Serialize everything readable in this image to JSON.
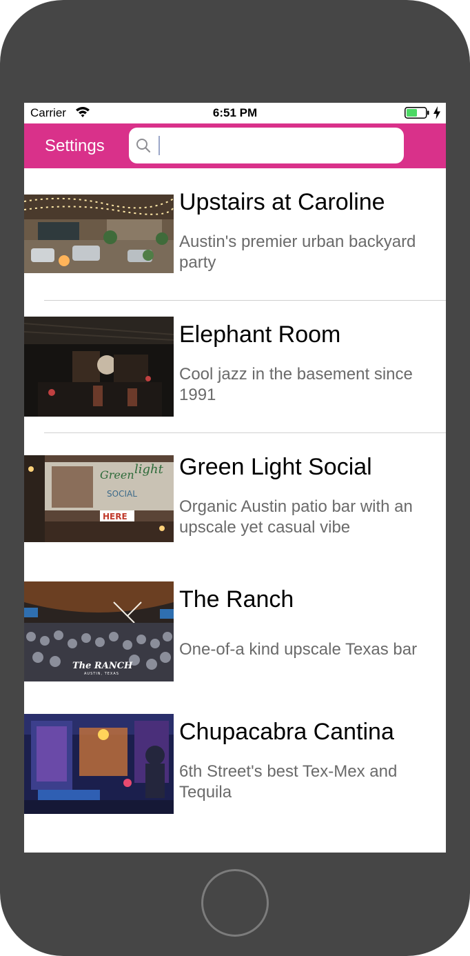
{
  "status_bar": {
    "carrier": "Carrier",
    "time": "6:51 PM",
    "battery_color": "#4cd964"
  },
  "nav_bar": {
    "settings_label": "Settings",
    "search_value": "",
    "search_placeholder": "",
    "background_color": "#d9318a"
  },
  "venues": [
    {
      "title": "Upstairs at Caroline",
      "description": "Austin's premier urban backyard party",
      "image": "rooftop-patio-photo"
    },
    {
      "title": "Elephant Room",
      "description": "Cool jazz in the basement since 1991",
      "image": "jazz-basement-photo"
    },
    {
      "title": "Green Light Social",
      "description": "Organic Austin patio bar with an upscale yet casual vibe",
      "image": "mural-bar-photo"
    },
    {
      "title": "The Ranch",
      "description": "One-of-a kind upscale Texas bar",
      "image": "crowded-bar-photo",
      "image_caption": "The RANCH",
      "image_subcaption": "AUSTIN, TEXAS"
    },
    {
      "title": "Chupacabra Cantina",
      "description": "6th Street's best Tex-Mex and Tequila",
      "image": "cantina-night-photo"
    }
  ]
}
